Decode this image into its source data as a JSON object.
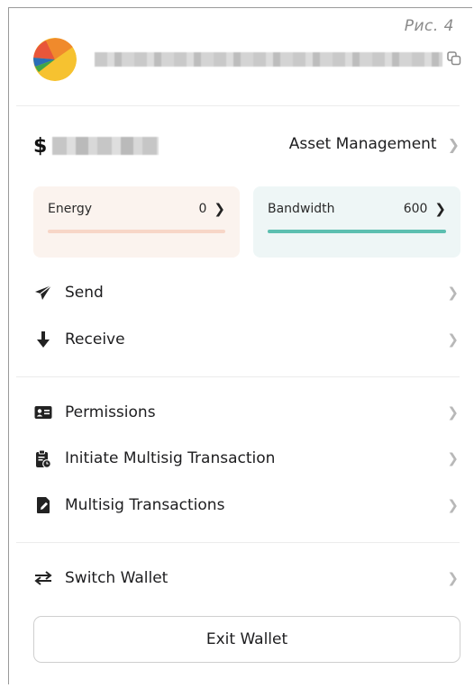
{
  "figure_label": "Рис. 4",
  "header": {
    "avatar_icon": "wallet-avatar-icon",
    "copy_icon": "copy-icon"
  },
  "balance": {
    "currency_symbol": "$"
  },
  "asset_management": {
    "label": "Asset Management"
  },
  "resources": {
    "energy": {
      "label": "Energy",
      "value": "0",
      "progress": 0,
      "color": "#f2b39a"
    },
    "bandwidth": {
      "label": "Bandwidth",
      "value": "600",
      "progress": 1.0,
      "color": "#5cbfb0"
    }
  },
  "actions": [
    {
      "label": "Send",
      "icon": "paper-plane-icon"
    },
    {
      "label": "Receive",
      "icon": "arrow-down-icon"
    }
  ],
  "permissions": [
    {
      "label": "Permissions",
      "icon": "id-card-icon"
    },
    {
      "label": "Initiate Multisig Transaction",
      "icon": "clipboard-clock-icon"
    },
    {
      "label": "Multisig Transactions",
      "icon": "document-edit-icon"
    }
  ],
  "switch_wallet": {
    "label": "Switch Wallet",
    "icon": "swap-arrows-icon"
  },
  "exit_button": {
    "label": "Exit Wallet"
  }
}
